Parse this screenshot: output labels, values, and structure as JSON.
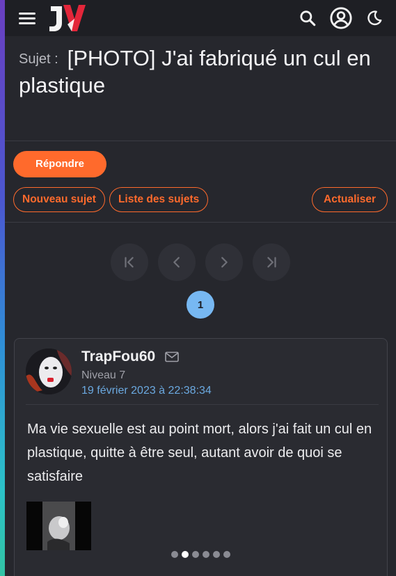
{
  "header": {
    "logo_text": "JV",
    "icons": [
      "hamburger-menu-icon",
      "search-icon",
      "account-icon",
      "moon-icon"
    ]
  },
  "topic": {
    "prefix": "Sujet :",
    "title": "[PHOTO] J'ai fabriqué un cul en plastique"
  },
  "actions": {
    "reply": "Répondre",
    "new_topic": "Nouveau sujet",
    "topic_list": "Liste des sujets",
    "refresh": "Actualiser"
  },
  "pagination": {
    "current_page": "1",
    "icons": [
      "first-page-icon",
      "prev-page-icon",
      "next-page-icon",
      "last-page-icon"
    ]
  },
  "post": {
    "author": "TrapFou60",
    "level": "Niveau 7",
    "date": "19 février 2023 à 22:38:34",
    "body": "Ma vie sexuelle est au point mort, alors j'ai fait un cul en plastique, quitte à être seul, autant avoir de quoi se satisfaire",
    "carousel": {
      "count": 6,
      "active_index": 1
    }
  },
  "colors": {
    "accent": "#ff6a2c",
    "page_bg": "#26272d",
    "topbar_bg": "#1e1f24",
    "link_blue": "#6ba9e0",
    "page_badge": "#77b8f2"
  }
}
